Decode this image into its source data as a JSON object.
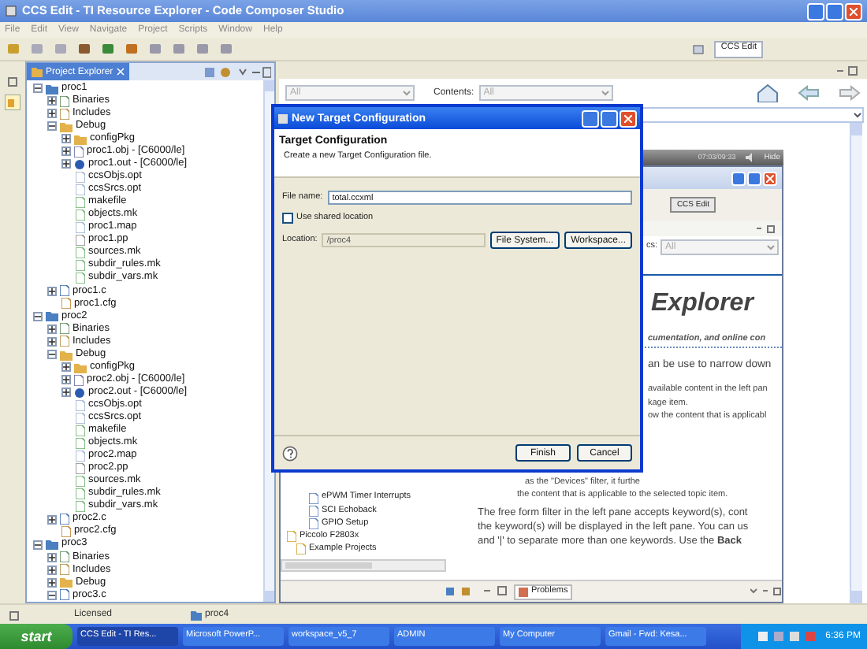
{
  "window": {
    "title": "CCS Edit - TI Resource Explorer - Code Composer Studio"
  },
  "menu": [
    "File",
    "Edit",
    "View",
    "Navigate",
    "Project",
    "Scripts",
    "Window",
    "Help"
  ],
  "toolbar": {
    "perspective": "CCS Edit"
  },
  "project_explorer": {
    "title": "Project Explorer",
    "tree": [
      {
        "label": "proc1",
        "kind": "project",
        "expanded": true,
        "children": [
          {
            "label": "Binaries",
            "kind": "binaries",
            "expanded": false
          },
          {
            "label": "Includes",
            "kind": "includes",
            "expanded": false
          },
          {
            "label": "Debug",
            "kind": "folder",
            "expanded": true,
            "children": [
              {
                "label": "configPkg",
                "kind": "folder",
                "expanded": false
              },
              {
                "label": "proc1.obj - [C6000/le]",
                "kind": "obj",
                "expanded": false
              },
              {
                "label": "proc1.out - [C6000/le]",
                "kind": "out",
                "expanded": false
              },
              {
                "label": "ccsObjs.opt",
                "kind": "file"
              },
              {
                "label": "ccsSrcs.opt",
                "kind": "file"
              },
              {
                "label": "makefile",
                "kind": "make"
              },
              {
                "label": "objects.mk",
                "kind": "make"
              },
              {
                "label": "proc1.map",
                "kind": "file"
              },
              {
                "label": "proc1.pp",
                "kind": "pp"
              },
              {
                "label": "sources.mk",
                "kind": "make"
              },
              {
                "label": "subdir_rules.mk",
                "kind": "make"
              },
              {
                "label": "subdir_vars.mk",
                "kind": "make"
              }
            ]
          },
          {
            "label": "proc1.c",
            "kind": "c",
            "expanded": false
          },
          {
            "label": "proc1.cfg",
            "kind": "cfg"
          }
        ]
      },
      {
        "label": "proc2",
        "kind": "project",
        "expanded": true,
        "children": [
          {
            "label": "Binaries",
            "kind": "binaries",
            "expanded": false
          },
          {
            "label": "Includes",
            "kind": "includes",
            "expanded": false
          },
          {
            "label": "Debug",
            "kind": "folder",
            "expanded": true,
            "children": [
              {
                "label": "configPkg",
                "kind": "folder",
                "expanded": false
              },
              {
                "label": "proc2.obj - [C6000/le]",
                "kind": "obj",
                "expanded": false
              },
              {
                "label": "proc2.out - [C6000/le]",
                "kind": "out",
                "expanded": false
              },
              {
                "label": "ccsObjs.opt",
                "kind": "file"
              },
              {
                "label": "ccsSrcs.opt",
                "kind": "file"
              },
              {
                "label": "makefile",
                "kind": "make"
              },
              {
                "label": "objects.mk",
                "kind": "make"
              },
              {
                "label": "proc2.map",
                "kind": "file"
              },
              {
                "label": "proc2.pp",
                "kind": "pp"
              },
              {
                "label": "sources.mk",
                "kind": "make"
              },
              {
                "label": "subdir_rules.mk",
                "kind": "make"
              },
              {
                "label": "subdir_vars.mk",
                "kind": "make"
              }
            ]
          },
          {
            "label": "proc2.c",
            "kind": "c",
            "expanded": false
          },
          {
            "label": "proc2.cfg",
            "kind": "cfg"
          }
        ]
      },
      {
        "label": "proc3",
        "kind": "project",
        "expanded": true,
        "children": [
          {
            "label": "Binaries",
            "kind": "binaries",
            "expanded": false
          },
          {
            "label": "Includes",
            "kind": "includes",
            "expanded": false
          },
          {
            "label": "Debug",
            "kind": "folder",
            "expanded": false
          },
          {
            "label": "proc3.c",
            "kind": "c",
            "expanded": true
          }
        ]
      }
    ]
  },
  "resource_explorer": {
    "filter": "All",
    "contents_label": "Contents:",
    "contents": "All",
    "embedded": {
      "player_time": "07:03/09:33",
      "player_hide": "Hide",
      "perspective": "CCS Edit",
      "filter_label": "cs:",
      "filter": "All",
      "heading": "Explorer",
      "subtitle": "cumentation, and online con",
      "lines": [
        "an be use to narrow down",
        "available content in the left pan",
        "kage item.",
        "ow the content that is applicabl",
        "as the \"Devices\" filter, it furthe",
        "the content that is applicable to the selected topic item."
      ],
      "paragraph": [
        "The free form filter in the left pane accepts keyword(s), cont",
        "the keyword(s) will be displayed in the left pane. You can us",
        "and '|' to separate more than one keywords. Use the **Back**"
      ],
      "tree": [
        {
          "label": "ePWM Timer Interrupts",
          "kind": "example"
        },
        {
          "label": "SCI Echoback",
          "kind": "example"
        },
        {
          "label": "GPIO Setup",
          "kind": "example"
        },
        {
          "label": "Piccolo F2803x",
          "kind": "device"
        },
        {
          "label": "Example Projects",
          "kind": "group"
        }
      ],
      "bottom_tab": "Problems"
    }
  },
  "dialog": {
    "title": "New Target Configuration",
    "heading": "Target Configuration",
    "description": "Create a new Target Configuration file.",
    "file_name_label": "File name:",
    "file_name": "total.ccxml",
    "shared": {
      "label": "Use shared location",
      "checked": false
    },
    "location_label": "Location:",
    "location": "/proc4",
    "buttons": [
      "File System...",
      "Workspace..."
    ],
    "footer_buttons": [
      "Finish",
      "Cancel"
    ]
  },
  "status_bar": {
    "license": "Licensed",
    "project": "proc4"
  },
  "taskbar": {
    "start": "start",
    "items": [
      "CCS Edit - TI Res...",
      "Microsoft PowerP...",
      "workspace_v5_7",
      "ADMIN",
      "My Computer",
      "Gmail - Fwd: Kesa..."
    ],
    "clock": "6:36 PM"
  }
}
